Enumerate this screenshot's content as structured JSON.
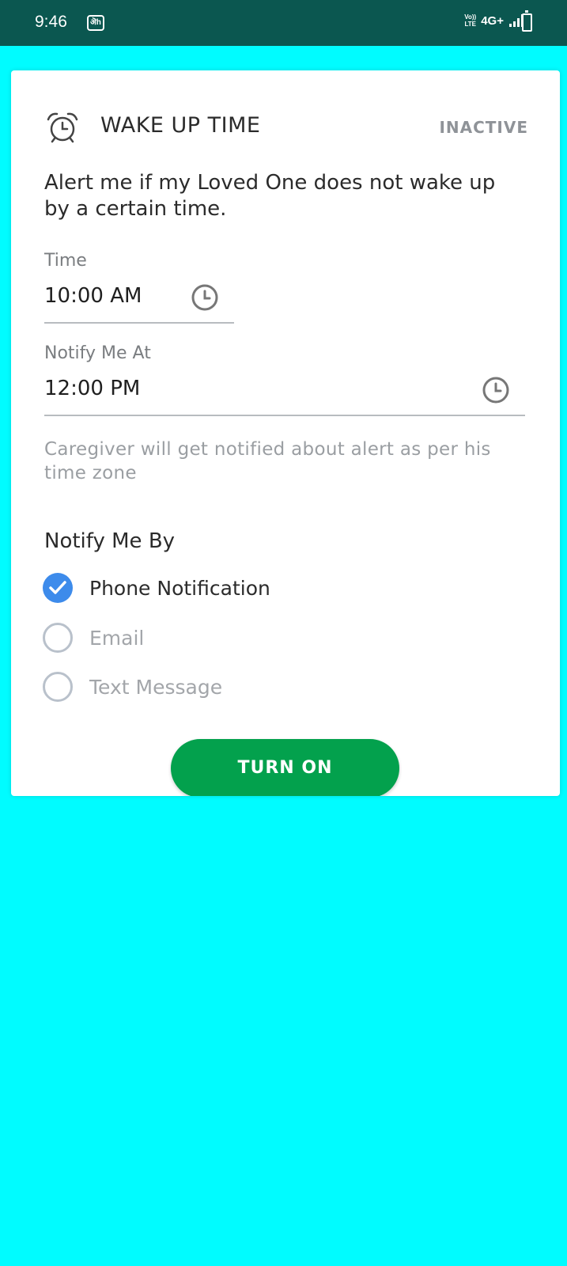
{
  "status_bar": {
    "time": "9:46",
    "app_icon_text": "ऄh",
    "volte_top": "Vo))",
    "volte_bottom": "LTE",
    "network": "4G+"
  },
  "card": {
    "title": "WAKE UP TIME",
    "status": "INACTIVE",
    "description": "Alert me if my Loved One does not wake up by a certain time.",
    "time_field": {
      "label": "Time",
      "value": "10:00 AM"
    },
    "notify_field": {
      "label": "Notify Me At",
      "value": "12:00 PM"
    },
    "help_text": "Caregiver will get notified about alert as per his time zone",
    "notify_by": {
      "title": "Notify Me By",
      "options": [
        {
          "label": "Phone Notification",
          "checked": true
        },
        {
          "label": "Email",
          "checked": false
        },
        {
          "label": "Text Message",
          "checked": false
        }
      ]
    },
    "button_label": "TURN ON"
  },
  "colors": {
    "status_bar": "#0B5750",
    "background": "#00FCFF",
    "accent_blue": "#3D8BEB",
    "button_green": "#03A14D"
  },
  "icons": [
    "alarm-clock-icon",
    "clock-icon",
    "check-icon",
    "battery-icon",
    "signal-icon"
  ]
}
